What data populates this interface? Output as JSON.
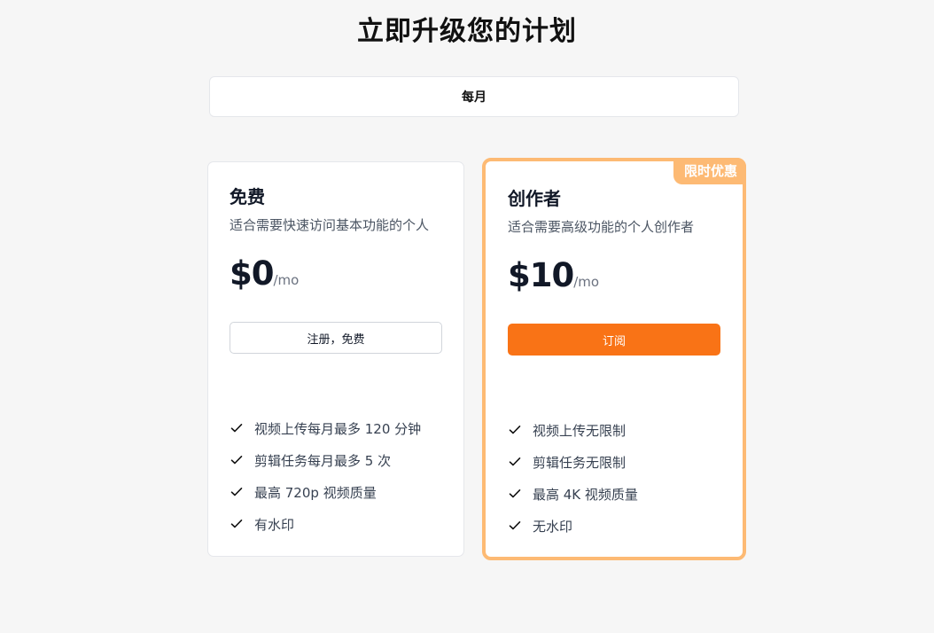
{
  "header": {
    "title": "立即升级您的计划"
  },
  "billing_toggle": {
    "label": "每月"
  },
  "plans": [
    {
      "name": "免费",
      "description": "适合需要快速访问基本功能的个人",
      "price": "$0",
      "period": "/mo",
      "button_label": "注册，免费",
      "features": [
        "视频上传每月最多 120 分钟",
        "剪辑任务每月最多 5 次",
        "最高 720p 视频质量",
        "有水印"
      ]
    },
    {
      "name": "创作者",
      "description": "适合需要高级功能的个人创作者",
      "price": "$10",
      "period": "/mo",
      "button_label": "订阅",
      "badge": "限时优惠",
      "features": [
        "视频上传无限制",
        "剪辑任务无限制",
        "最高 4K 视频质量",
        "无水印"
      ]
    }
  ],
  "colors": {
    "accent": "#f97316",
    "highlight_border": "#fdba74",
    "background": "#f6f6f6"
  },
  "icons": {
    "feature_check": "check-icon"
  }
}
